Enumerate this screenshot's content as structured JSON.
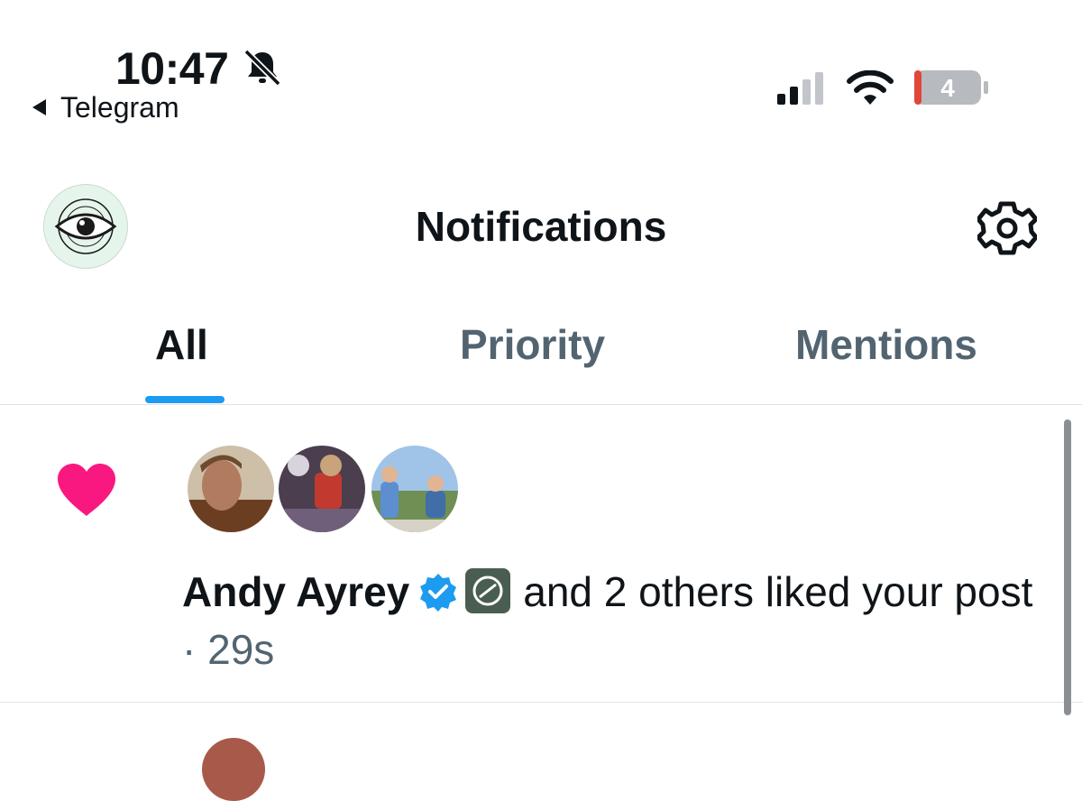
{
  "status_bar": {
    "time": "10:47",
    "back_app": "Telegram",
    "battery_level": "4",
    "icons": [
      "bell-slash-icon",
      "cellular-signal-icon",
      "wifi-icon",
      "battery-icon"
    ]
  },
  "header": {
    "title": "Notifications",
    "icons": [
      "profile-avatar",
      "settings-gear-icon"
    ]
  },
  "tabs": [
    {
      "label": "All",
      "active": true
    },
    {
      "label": "Priority",
      "active": false
    },
    {
      "label": "Mentions",
      "active": false
    }
  ],
  "notification": {
    "icon": "heart-icon",
    "user": "Andy Ayrey",
    "rest": "and 2 others liked your post",
    "separator": "·",
    "time_ago": "29s"
  },
  "colors": {
    "accent": "#1d9bf0",
    "heart": "#f91880",
    "muted_text": "#536471"
  }
}
